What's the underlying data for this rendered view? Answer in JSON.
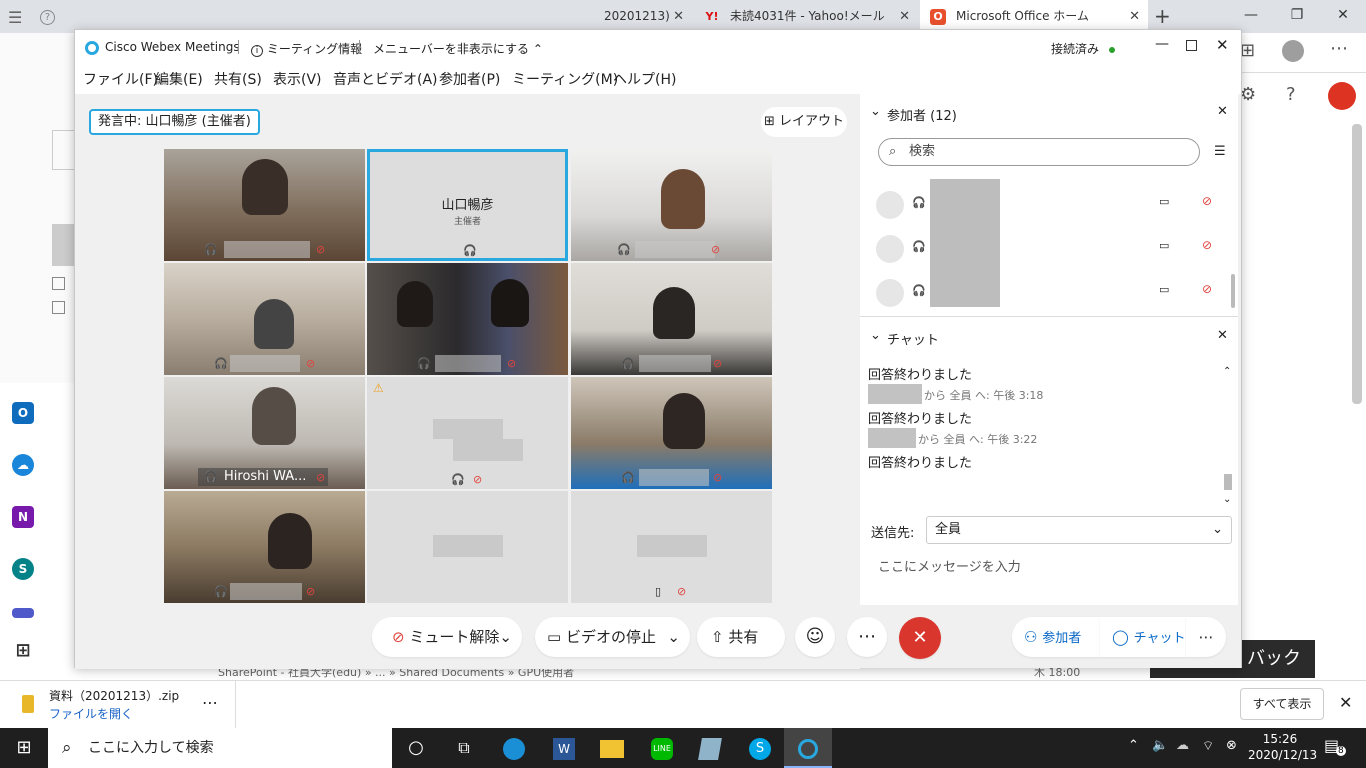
{
  "browser": {
    "tabs": [
      {
        "label": "20201213)"
      },
      {
        "label": "未読4031件 - Yahoo!メール"
      },
      {
        "label": "Microsoft Office ホーム"
      }
    ],
    "feedback_label": "バック",
    "file_row": {
      "path": "SharePoint - 社員大学(edu) » ... » Shared Documents » GPU使用者",
      "time": "木 18:00"
    }
  },
  "webex": {
    "app_title": "Cisco Webex Meetings",
    "meeting_info": "ミーティング情報",
    "hide_menubar": "メニューバーを非表示にする",
    "connection_status": "接続済み",
    "menu": [
      "ファイル(F)",
      "編集(E)",
      "共有(S)",
      "表示(V)",
      "音声とビデオ(A)",
      "参加者(P)",
      "ミーティング(M)",
      "ヘルプ(H)"
    ],
    "speaker_label": "発言中: 山口暢彦 (主催者)",
    "layout_button": "レイアウト",
    "tiles": [
      {
        "kind": "video",
        "name": ""
      },
      {
        "kind": "host",
        "name": "山口暢彦",
        "role": "主催者"
      },
      {
        "kind": "video",
        "name": ""
      },
      {
        "kind": "video",
        "name": ""
      },
      {
        "kind": "video",
        "name": ""
      },
      {
        "kind": "video",
        "name": ""
      },
      {
        "kind": "video",
        "name": "Hiroshi WA..."
      },
      {
        "kind": "blank",
        "name": ""
      },
      {
        "kind": "video",
        "name": ""
      },
      {
        "kind": "video",
        "name": ""
      },
      {
        "kind": "blank",
        "name": ""
      },
      {
        "kind": "blank",
        "name": ""
      }
    ],
    "participants_title": "参加者 (12)",
    "search_placeholder": "検索",
    "chat_title": "チャット",
    "chat_messages": [
      {
        "text": "回答終わりました"
      },
      {
        "meta": "から 全員 へ:  午後 3:18"
      },
      {
        "text": "回答終わりました"
      },
      {
        "meta": "から 全員 へ:  午後 3:22"
      },
      {
        "text": "回答終わりました"
      }
    ],
    "send_to_label": "送信先:",
    "send_to_value": "全員",
    "message_placeholder": "ここにメッセージを入力",
    "controls": {
      "unmute": "ミュート解除",
      "stop_video": "ビデオの停止",
      "share": "共有",
      "participants": "参加者",
      "chat": "チャット"
    }
  },
  "downloads": {
    "file_name": "資料（20201213）.zip",
    "open_link": "ファイルを開く",
    "show_all": "すべて表示"
  },
  "taskbar": {
    "search_placeholder": "ここに入力して検索",
    "time": "15:26",
    "date": "2020/12/13",
    "notification_count": "8"
  }
}
